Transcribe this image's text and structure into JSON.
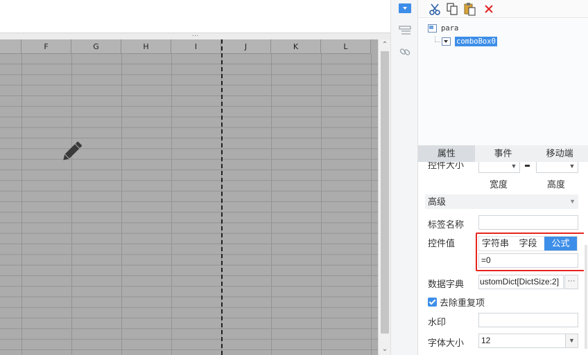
{
  "sheet": {
    "splitter_handle": "···",
    "columns": [
      "",
      "F",
      "G",
      "H",
      "I",
      "J",
      "K",
      "L"
    ],
    "scroll_up": "⌃",
    "scroll_down": "⌄"
  },
  "tree": {
    "root": "para",
    "child": "comboBox0"
  },
  "tabs": [
    "属性",
    "事件",
    "移动端"
  ],
  "props": {
    "cut_off_label": "控件大小",
    "width_label": "宽度",
    "height_label": "高度",
    "advanced_section": "高级",
    "tag_name_label": "标签名称",
    "tag_name_value": "",
    "widget_value_label": "控件值",
    "value_types": [
      "字符串",
      "字段",
      "公式"
    ],
    "selected_value_type": "公式",
    "formula_value": "=0",
    "data_dict_label": "数据字典",
    "data_dict_value": "ustomDict[DictSize:2]",
    "data_dict_more": "···",
    "remove_dup_label": "去除重复项",
    "remove_dup_checked": true,
    "watermark_label": "水印",
    "watermark_value": "",
    "font_size_label": "字体大小",
    "font_size_value": "12"
  },
  "colors": {
    "accent": "#3d8ee8",
    "highlight_border": "#e8241c",
    "sheet_bg": "#acacac"
  }
}
